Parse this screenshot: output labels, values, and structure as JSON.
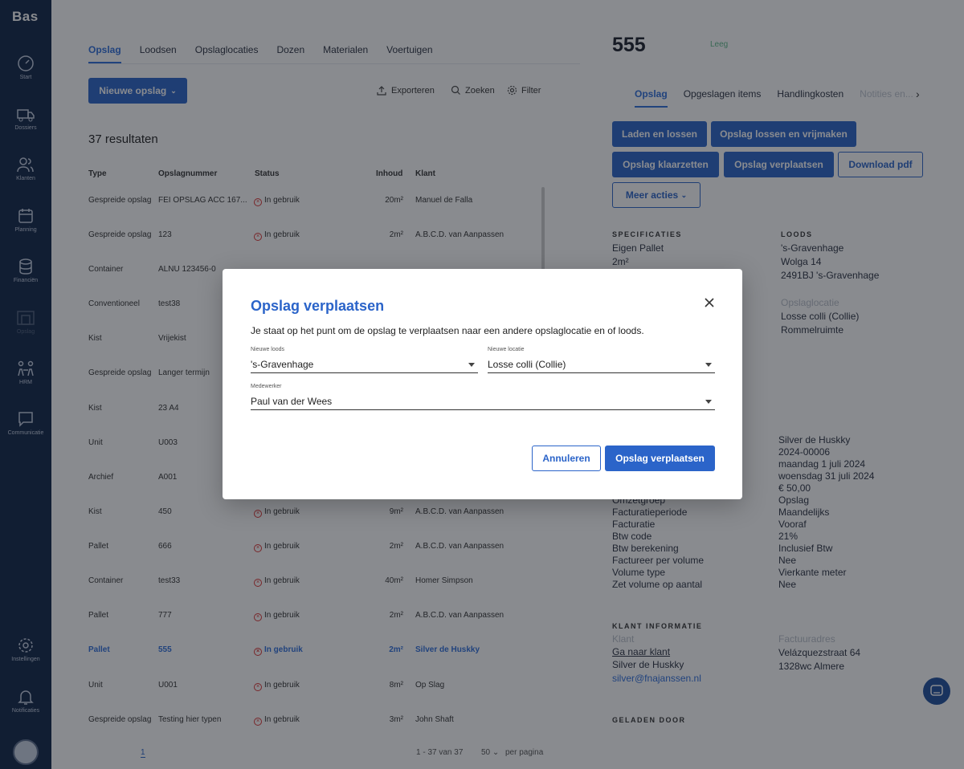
{
  "app": {
    "brand": "Bas"
  },
  "sidebar": {
    "items": [
      {
        "label": "Start",
        "icon": "gauge-icon"
      },
      {
        "label": "Dossiers",
        "icon": "truck-icon"
      },
      {
        "label": "Klanten",
        "icon": "users-icon"
      },
      {
        "label": "Planning",
        "icon": "calendar-icon"
      },
      {
        "label": "Financiën",
        "icon": "coins-icon"
      },
      {
        "label": "Opslag",
        "icon": "warehouse-icon"
      },
      {
        "label": "HRM",
        "icon": "people-icon"
      },
      {
        "label": "Communicatie",
        "icon": "chat-icon"
      },
      {
        "label": "Instellingen",
        "icon": "gear-icon"
      },
      {
        "label": "Notificaties",
        "icon": "bell-icon"
      }
    ]
  },
  "tabs": [
    "Opslag",
    "Loodsen",
    "Opslaglocaties",
    "Dozen",
    "Materialen",
    "Voertuigen"
  ],
  "toolbar": {
    "new_label": "Nieuwe opslag",
    "export": "Exporteren",
    "search": "Zoeken",
    "filter": "Filter"
  },
  "results": {
    "count": "37 resultaten"
  },
  "table": {
    "headers": [
      "Type",
      "Opslagnummer",
      "Status",
      "Inhoud",
      "Klant"
    ],
    "rows": [
      [
        "Gespreide opslag",
        "FEI OPSLAG ACC 167...",
        "In gebruik",
        "20m²",
        "Manuel de Falla"
      ],
      [
        "Gespreide opslag",
        "123",
        "In gebruik",
        "2m²",
        "A.B.C.D. van Aanpassen"
      ],
      [
        "Container",
        "ALNU 123456-0",
        "",
        "",
        ""
      ],
      [
        "Conventioneel",
        "test38",
        "",
        "",
        ""
      ],
      [
        "Kist",
        "Vrijekist",
        "",
        "",
        ""
      ],
      [
        "Gespreide opslag",
        "Langer termijn",
        "",
        "",
        ""
      ],
      [
        "Kist",
        "23 A4",
        "",
        "",
        ""
      ],
      [
        "Unit",
        "U003",
        "",
        "",
        ""
      ],
      [
        "Archief",
        "A001",
        "",
        "",
        ""
      ],
      [
        "Kist",
        "450",
        "In gebruik",
        "9m²",
        "A.B.C.D. van Aanpassen"
      ],
      [
        "Pallet",
        "666",
        "In gebruik",
        "2m²",
        "A.B.C.D. van Aanpassen"
      ],
      [
        "Container",
        "test33",
        "In gebruik",
        "40m²",
        "Homer Simpson"
      ],
      [
        "Pallet",
        "777",
        "In gebruik",
        "2m²",
        "A.B.C.D. van Aanpassen"
      ],
      [
        "Pallet",
        "555",
        "In gebruik",
        "2m²",
        "Silver de Huskky"
      ],
      [
        "Unit",
        "U001",
        "In gebruik",
        "8m²",
        "Op Slag"
      ],
      [
        "Gespreide opslag",
        "Testing hier typen",
        "In gebruik",
        "3m²",
        "John Shaft"
      ]
    ]
  },
  "pagination": {
    "page": "1",
    "range": "1 - 37 van 37",
    "per_page": "50",
    "per_page_label": "per pagina"
  },
  "detail": {
    "title": "555",
    "tag": "Leeg",
    "tabs": [
      "Opslag",
      "Opgeslagen items",
      "Handlingkosten",
      "Notities en..."
    ],
    "actions": [
      "Laden en lossen",
      "Opslag lossen en vrijmaken",
      "Opslag klaarzetten",
      "Opslag verplaatsen",
      "Download pdf",
      "Meer acties"
    ],
    "spec_header": "SPECIFICATIES",
    "spec": [
      "Eigen Pallet",
      "2m²"
    ],
    "loods_header": "LOODS",
    "loods": [
      "'s-Gravenhage",
      "Wolga 14",
      "2491BJ 's-Gravenhage"
    ],
    "locatie_label": "Opslaglocatie",
    "locatie": [
      "Losse colli (Collie)",
      "Rommelruimte"
    ],
    "facturatie_values": [
      "Silver de Huskky",
      "2024-00006",
      "maandag 1 juli 2024",
      "woensdag 31 juli 2024",
      "€ 50,00"
    ],
    "facturatie_rows": [
      [
        "Omzetgroep",
        "Opslag"
      ],
      [
        "Facturatieperiode",
        "Maandelijks"
      ],
      [
        "Facturatie",
        "Vooraf"
      ],
      [
        "Btw code",
        "21%"
      ],
      [
        "Btw berekening",
        "Inclusief Btw"
      ],
      [
        "Factureer per volume",
        "Nee"
      ],
      [
        "Volume type",
        "Vierkante meter"
      ],
      [
        "Zet volume op aantal",
        "Nee"
      ]
    ],
    "klant_header": "KLANT INFORMATIE",
    "klant_label": "Klant",
    "klant_link": "Ga naar klant",
    "klant_name": "Silver de Huskky",
    "klant_email": "silver@fnajanssen.nl",
    "factuur_label": "Factuuradres",
    "factuur": [
      "Velázquezstraat 64",
      "1328wc Almere"
    ],
    "geladen_header": "GELADEN DOOR"
  },
  "modal": {
    "title": "Opslag verplaatsen",
    "description": "Je staat op het punt om de opslag te verplaatsen naar een andere opslaglocatie en of loods.",
    "loods_label": "Nieuwe loods",
    "loods_value": "'s-Gravenhage",
    "locatie_label": "Nieuwe locatie",
    "locatie_value": "Losse colli (Collie)",
    "medewerker_label": "Medewerker",
    "medewerker_value": "Paul van der Wees",
    "cancel": "Annuleren",
    "confirm": "Opslag verplaatsen"
  },
  "colors": {
    "sidebar": "#0f2446",
    "accent": "#2b64c9",
    "danger": "#d33333"
  }
}
